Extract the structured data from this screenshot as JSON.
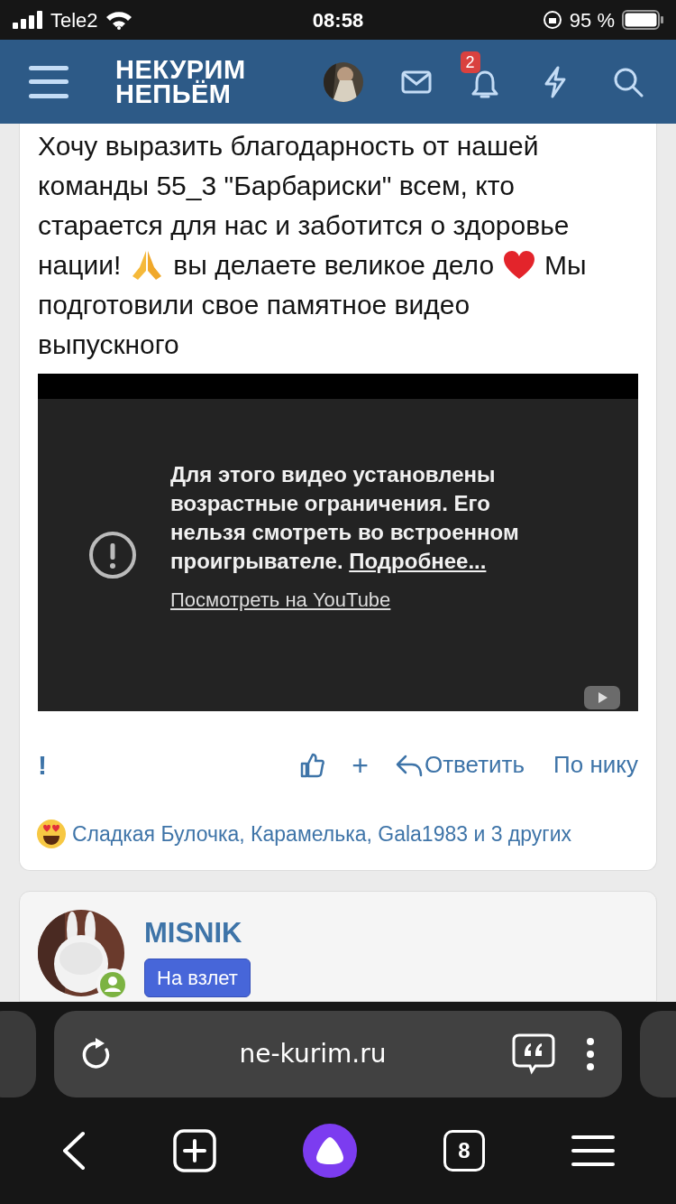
{
  "status_bar": {
    "carrier": "Tele2",
    "time": "08:58",
    "battery": "95 %"
  },
  "header": {
    "logo_line_1": "НЕКУРИМ",
    "logo_line_2": "НЕПЬЁМ",
    "notifications_badge": "2"
  },
  "post": {
    "body": [
      [
        {
          "kind": "text",
          "text": "Хочу выразить благодарность от нашей"
        }
      ],
      [
        {
          "kind": "text",
          "text": "команды 55_3 \"Барбариски\" всем, кто"
        }
      ],
      [
        {
          "kind": "text",
          "text": "старается для нас и заботится о здоровье"
        }
      ],
      [
        {
          "kind": "text",
          "text": "нации!"
        },
        {
          "kind": "hands"
        },
        {
          "kind": "text",
          "text": "вы делаете великое дело"
        },
        {
          "kind": "heart"
        },
        {
          "kind": "text",
          "text": "Мы"
        }
      ],
      [
        {
          "kind": "text",
          "text": "подготовили свое памятное видео"
        }
      ],
      [
        {
          "kind": "text",
          "text": "выпускного"
        }
      ]
    ],
    "video": {
      "message": "Для этого видео установлены возрастные ограничения. Его нельзя смотреть во встроенном проигрывателе.",
      "more_link": "Подробнее...",
      "watch_link": "Посмотреть на YouTube"
    },
    "actions": {
      "report": "!",
      "add": "+",
      "reply": "Ответить",
      "by_nick": "По нику"
    },
    "reactions": "Сладкая Булочка, Карамелька, Gala1983 и 3 других"
  },
  "next_post": {
    "author": "MISNIK",
    "title_badge": "На взлет",
    "online": true
  },
  "browser": {
    "address": "ne-kurim.ru",
    "tabs_count": "8"
  }
}
